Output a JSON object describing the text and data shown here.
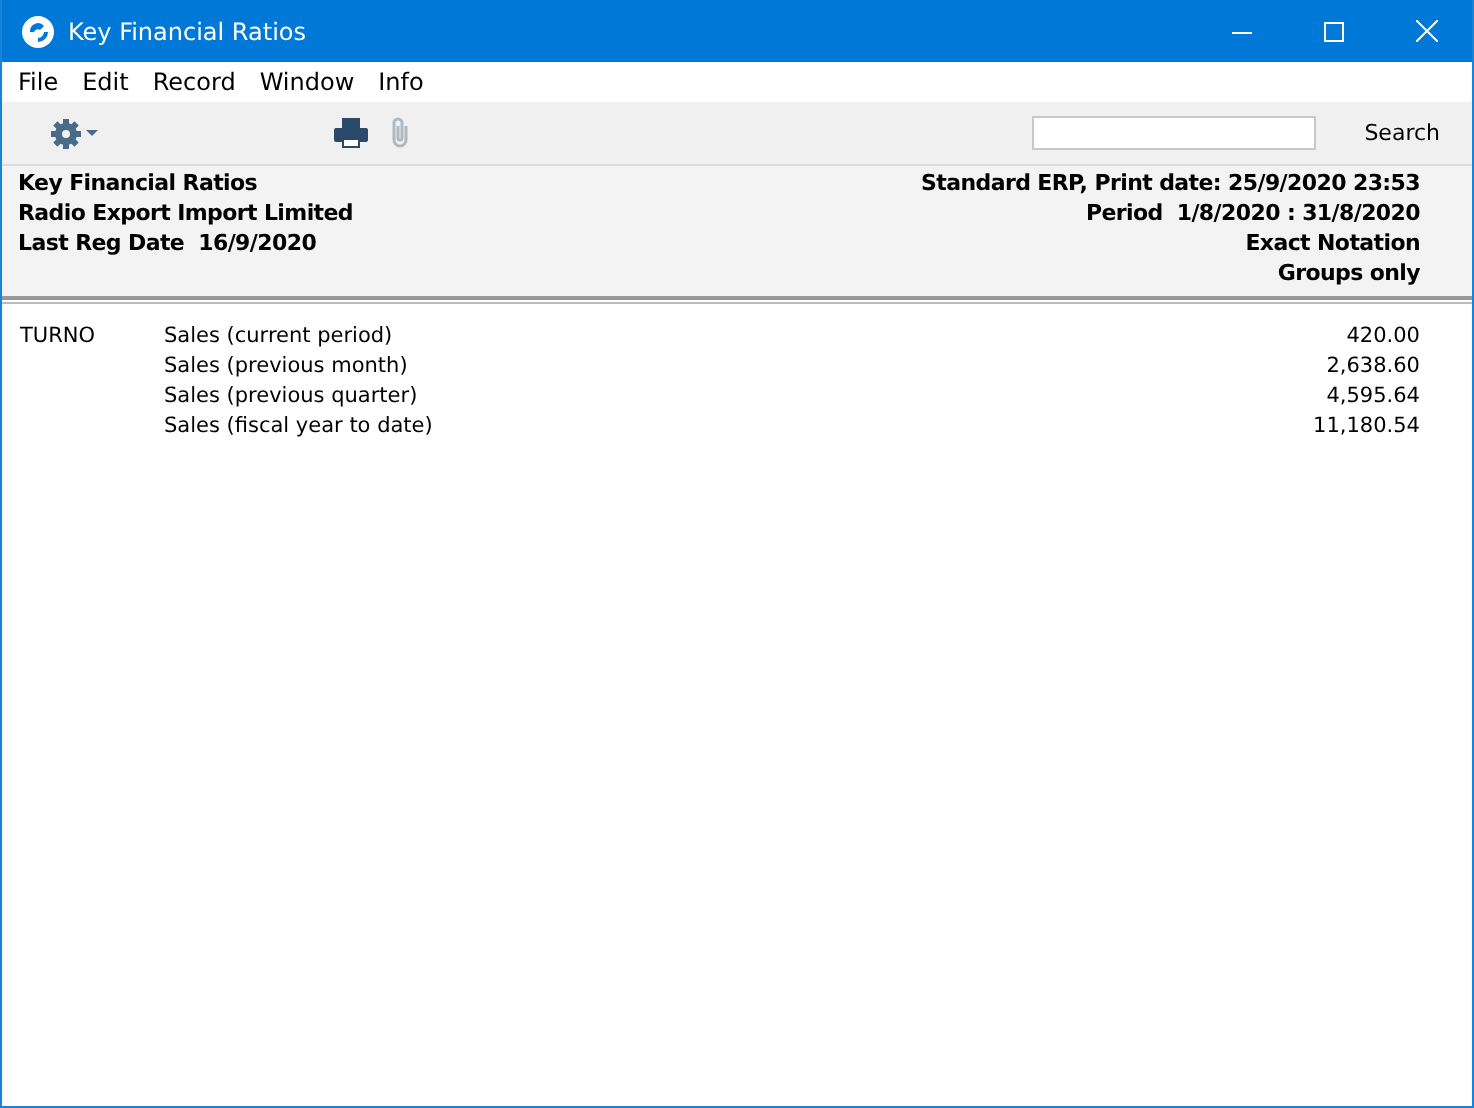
{
  "window": {
    "title": "Key Financial Ratios"
  },
  "menu": [
    "File",
    "Edit",
    "Record",
    "Window",
    "Info"
  ],
  "toolbar": {
    "search_button": "Search"
  },
  "header": {
    "left": [
      "Key Financial Ratios",
      "Radio Export Import Limited",
      "Last Reg Date  16/9/2020"
    ],
    "right": [
      "Standard ERP, Print date: 25/9/2020 23:53",
      "Period  1/8/2020 : 31/8/2020",
      "Exact Notation",
      "Groups only"
    ]
  },
  "rows": [
    {
      "code": "TURNO",
      "label": "Sales (current period)",
      "value": "420.00"
    },
    {
      "label": "Sales (previous month)",
      "value": "2,638.60"
    },
    {
      "label": "Sales (previous quarter)",
      "value": "4,595.64"
    },
    {
      "label": "Sales (fiscal year to date)",
      "value": "11,180.54"
    }
  ]
}
